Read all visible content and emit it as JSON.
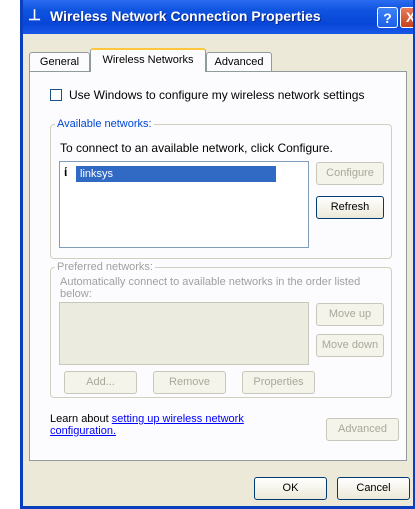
{
  "window": {
    "title": "Wireless Network Connection Properties",
    "help_label": "?",
    "close_label": "X"
  },
  "tabs": [
    {
      "label": "General",
      "active": false
    },
    {
      "label": "Wireless Networks",
      "active": true
    },
    {
      "label": "Advanced",
      "active": false
    }
  ],
  "use_windows": {
    "label": "Use Windows to configure my wireless network settings",
    "checked": false
  },
  "available": {
    "title": "Available networks:",
    "description": "To connect to an available network, click Configure.",
    "networks": [
      {
        "name": "linksys",
        "icon": "antenna-icon",
        "selected": true
      }
    ],
    "configure_label": "Configure",
    "refresh_label": "Refresh"
  },
  "preferred": {
    "title": "Preferred networks:",
    "description": "Automatically connect to available networks in the order listed below:",
    "move_up_label": "Move up",
    "move_down_label": "Move down",
    "add_label": "Add...",
    "remove_label": "Remove",
    "properties_label": "Properties"
  },
  "learn": {
    "prefix": "Learn about ",
    "link": "setting up wireless network configuration."
  },
  "advanced_label": "Advanced",
  "ok_label": "OK",
  "cancel_label": "Cancel"
}
